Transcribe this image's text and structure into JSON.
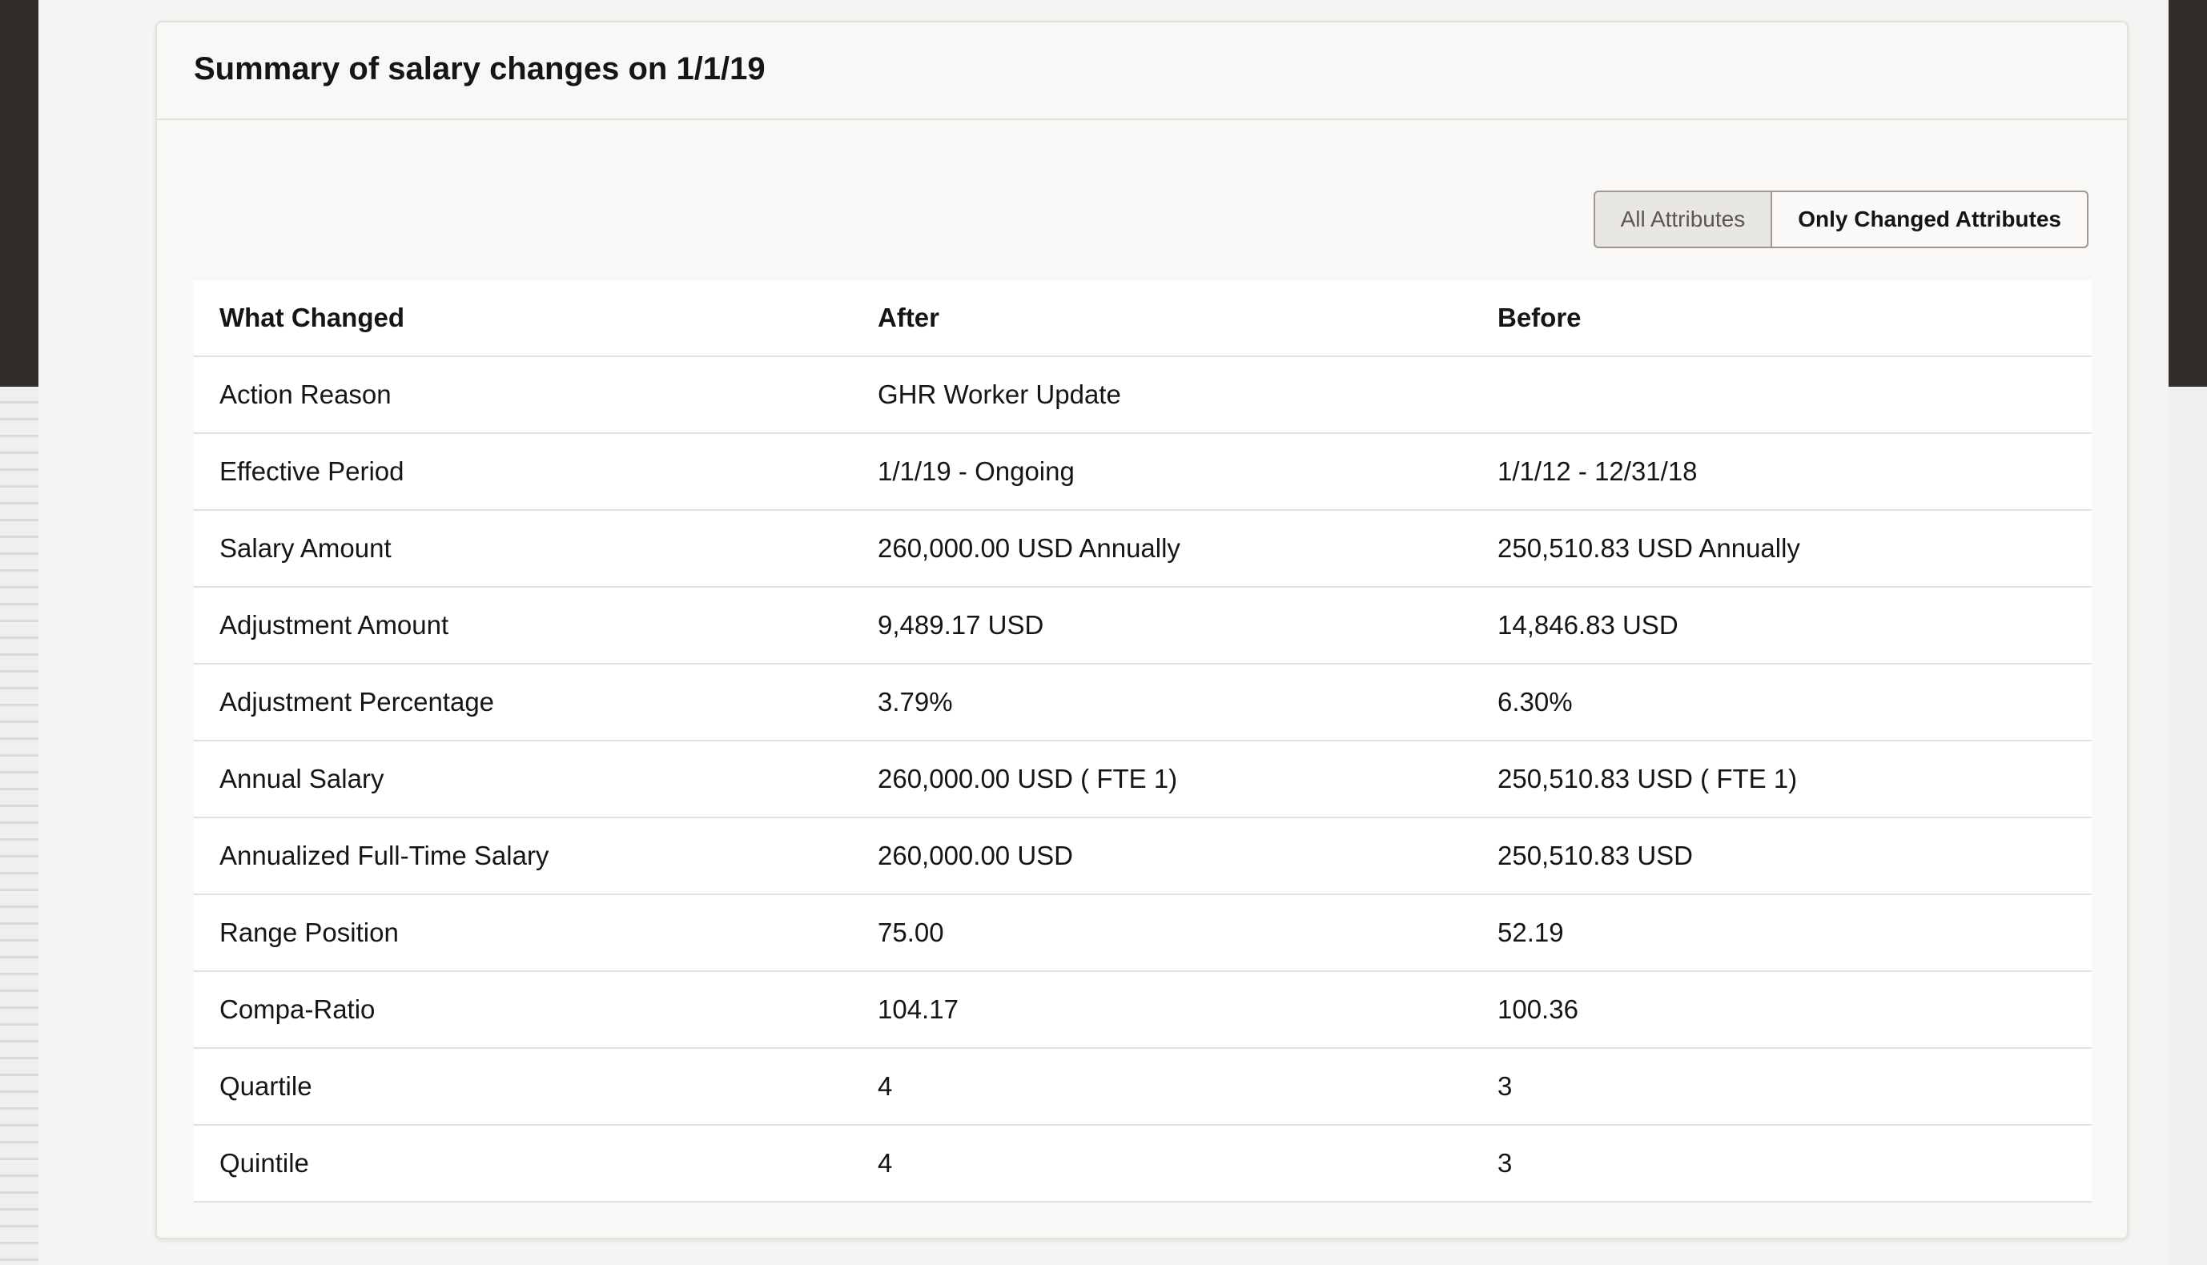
{
  "title": "Summary of salary changes on 1/1/19",
  "toggle": {
    "all_label": "All Attributes",
    "changed_label": "Only Changed Attributes"
  },
  "table": {
    "headers": [
      "What Changed",
      "After",
      "Before"
    ],
    "rows": [
      [
        "Action Reason",
        "GHR Worker Update",
        ""
      ],
      [
        "Effective Period",
        "1/1/19 - Ongoing",
        "1/1/12 - 12/31/18"
      ],
      [
        "Salary Amount",
        "260,000.00 USD Annually",
        "250,510.83 USD Annually"
      ],
      [
        "Adjustment Amount",
        "9,489.17 USD",
        "14,846.83 USD"
      ],
      [
        "Adjustment Percentage",
        "3.79%",
        "6.30%"
      ],
      [
        "Annual Salary",
        "260,000.00 USD ( FTE 1)",
        "250,510.83 USD ( FTE 1)"
      ],
      [
        "Annualized Full-Time Salary",
        "260,000.00 USD",
        "250,510.83 USD"
      ],
      [
        "Range Position",
        "75.00",
        "52.19"
      ],
      [
        "Compa-Ratio",
        "104.17",
        "100.36"
      ],
      [
        "Quartile",
        "4",
        "3"
      ],
      [
        "Quintile",
        "4",
        "3"
      ]
    ]
  }
}
